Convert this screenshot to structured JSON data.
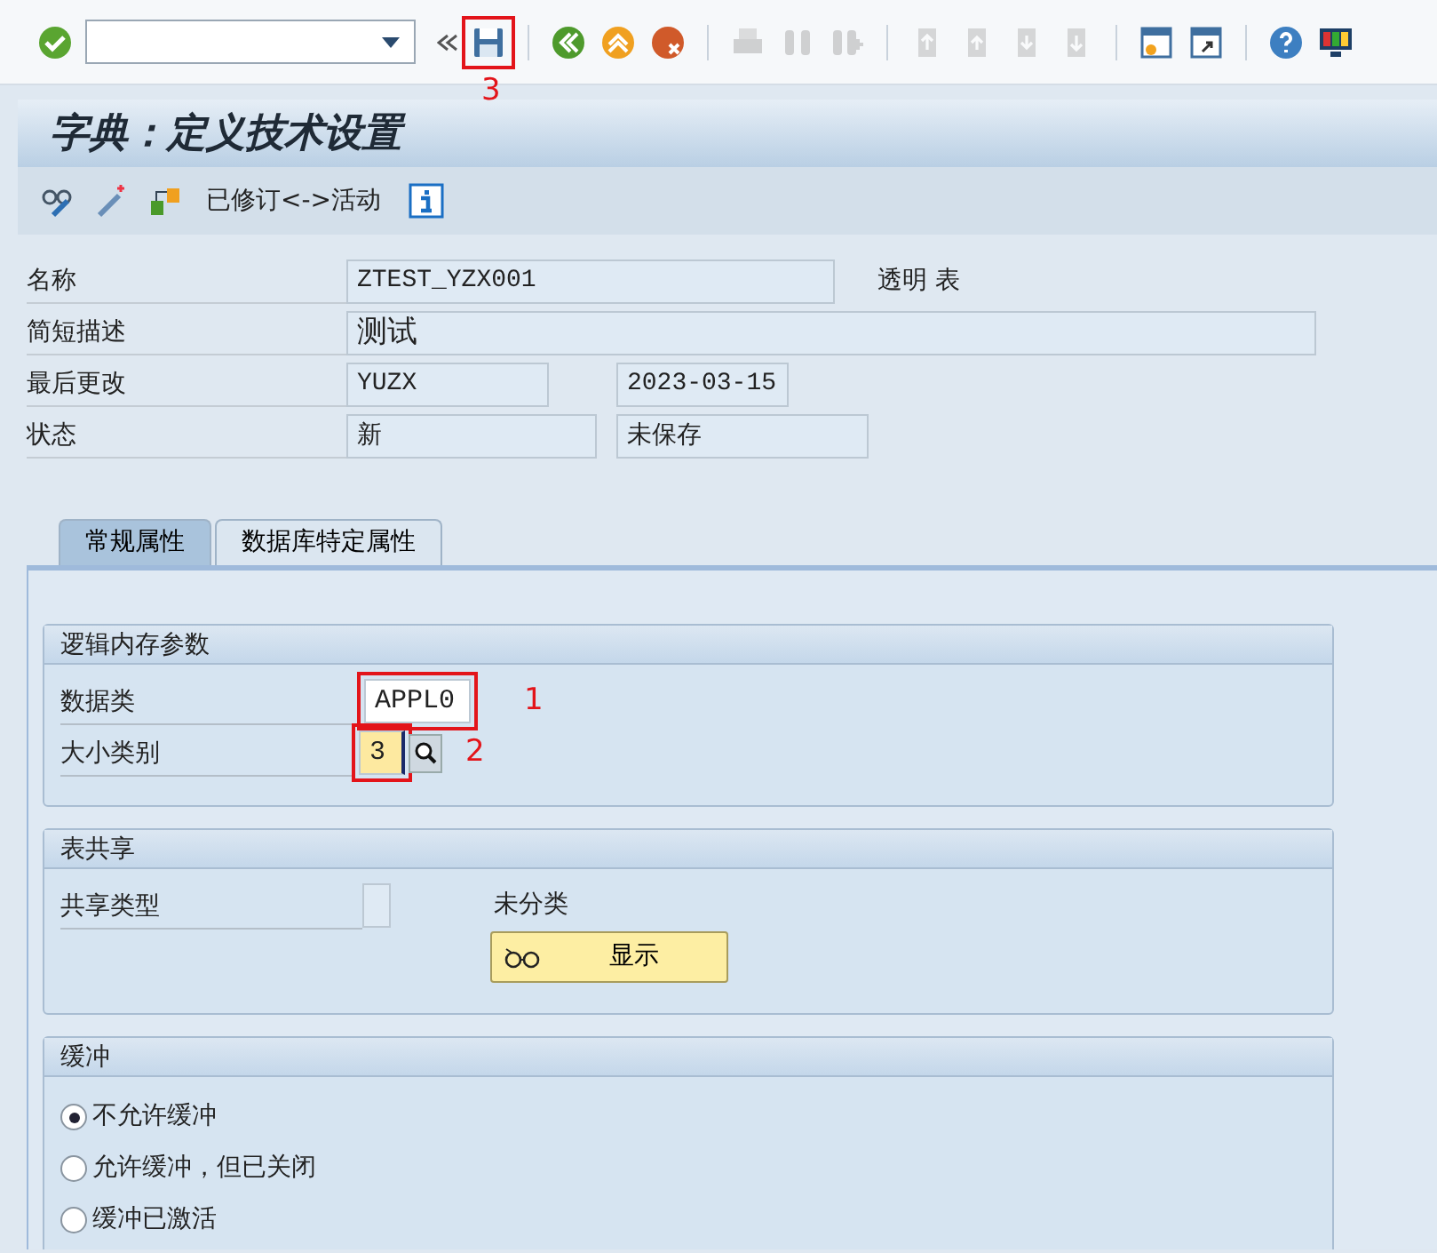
{
  "toolbar": {
    "buttons": [
      {
        "disabled": false
      },
      {
        "disabled": false,
        "marker": "3"
      },
      {
        "disabled": false
      },
      {
        "disabled": false
      },
      {
        "disabled": false
      },
      {
        "disabled": true
      },
      {
        "disabled": true
      },
      {
        "disabled": true
      },
      {
        "disabled": true
      },
      {
        "disabled": true
      },
      {
        "disabled": true
      },
      {
        "disabled": true
      },
      {
        "disabled": false
      },
      {
        "disabled": false
      },
      {
        "disabled": false
      },
      {
        "disabled": false
      }
    ]
  },
  "title": "字典：定义技术设置",
  "app_toolbar": {
    "label": "已修订<->活动"
  },
  "header_fields": [
    {
      "label": "名称",
      "fields": [
        {
          "value": "ZTEST_YZX001"
        }
      ],
      "note": "透明 表"
    },
    {
      "label": "简短描述",
      "fields": [
        {
          "value": "测试"
        }
      ]
    },
    {
      "label": "最后更改",
      "fields": [
        {
          "value": "YUZX"
        },
        {
          "value": "2023-03-15"
        }
      ]
    },
    {
      "label": "状态",
      "fields": [
        {
          "value": "新"
        },
        {
          "value": "未保存"
        }
      ]
    }
  ],
  "tabs": [
    {
      "label": "常规属性",
      "selected": true
    },
    {
      "label": "数据库特定属性",
      "selected": false
    }
  ],
  "logical_storage": {
    "title": "逻辑内存参数",
    "fields": [
      {
        "label": "数据类",
        "value": "APPL0",
        "focused": false,
        "marker": "1"
      },
      {
        "label": "大小类别",
        "value": "3",
        "focused": true,
        "marker": "2"
      }
    ]
  },
  "table_sharing": {
    "title": "表共享",
    "label": "共享类型",
    "status": "未分类",
    "button": "显示"
  },
  "buffering": {
    "title": "缓冲",
    "options": [
      {
        "label": "不允许缓冲",
        "selected": true
      },
      {
        "label": "允许缓冲，但已关闭",
        "selected": false
      },
      {
        "label": "缓冲已激活",
        "selected": false
      }
    ]
  }
}
